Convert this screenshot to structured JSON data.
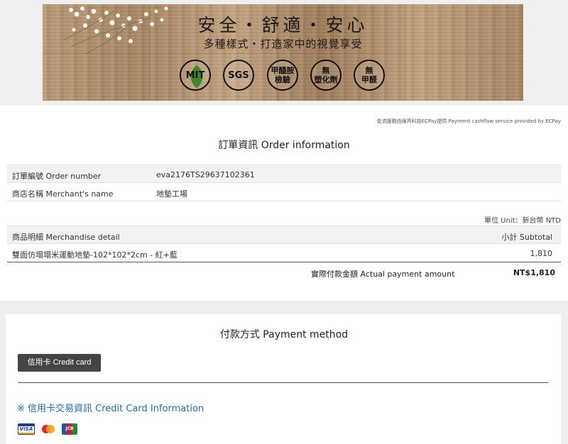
{
  "banner": {
    "title": "安全・舒適・安心",
    "subtitle": "多種樣式・打造家中的視覺享受",
    "badges": [
      {
        "line1": "MIT",
        "line2": ""
      },
      {
        "line1": "SGS",
        "line2": ""
      },
      {
        "line1": "甲醯胺",
        "line2": "檢驗"
      },
      {
        "line1": "無",
        "line2": "塑化劑"
      },
      {
        "line1": "無",
        "line2": "甲醛"
      }
    ]
  },
  "provider_note": "金流服務由綠界科技ECPay提供 Payment cashflow service provided by ECPay",
  "order": {
    "title": "訂單資訊 Order information",
    "order_number_label": "訂單編號 Order number",
    "order_number_value": "eva2176TS29637102361",
    "merchant_label": "商店名稱 Merchant's name",
    "merchant_value": "地墊工場",
    "unit_note": "單位 Unit：新台幣 NTD",
    "detail_header": "商品明細 Merchandise detail",
    "subtotal_header": "小計 Subtotal",
    "items": [
      {
        "name": "雙面仿塌塌米運動地墊-102*102*2cm - 紅+藍",
        "subtotal": "1,810"
      }
    ],
    "total_label": "實際付款金額 Actual payment amount",
    "total_value": "NT$1,810"
  },
  "payment": {
    "title": "付款方式 Payment method",
    "credit_card_button": "信用卡 Credit card",
    "cc_info_title": "※ 信用卡交易資訊 Credit Card Information",
    "card_logos": [
      "VISA",
      "JCB"
    ]
  },
  "colors": {
    "accent_blue": "#1a6fb0",
    "button_dark": "#444444"
  }
}
